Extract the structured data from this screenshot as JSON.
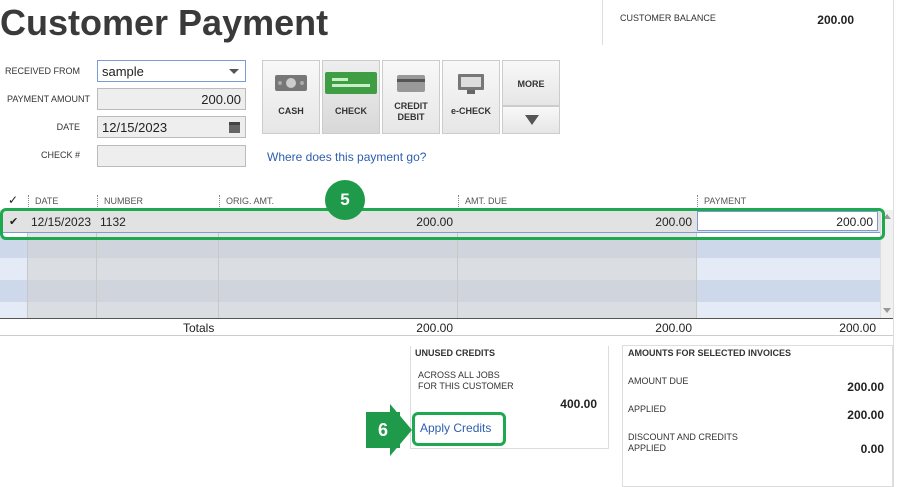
{
  "header": {
    "title": "Customer Payment",
    "customer_balance_label": "CUSTOMER BALANCE",
    "customer_balance_value": "200.00"
  },
  "form": {
    "received_from_label": "RECEIVED FROM",
    "received_from_value": "sample",
    "payment_amount_label": "PAYMENT AMOUNT",
    "payment_amount_value": "200.00",
    "date_label": "DATE",
    "date_value": "12/15/2023",
    "check_label": "CHECK #",
    "check_value": ""
  },
  "payment_methods": [
    {
      "label": "CASH",
      "icon": "cash-icon"
    },
    {
      "label": "CHECK",
      "icon": "check-icon"
    },
    {
      "label": "CREDIT\nDEBIT",
      "icon": "credit-card-icon"
    },
    {
      "label": "e-CHECK",
      "icon": "echeck-icon"
    },
    {
      "label": "MORE",
      "icon": "chevron-down-icon"
    }
  ],
  "where_link": "Where does this payment go?",
  "table": {
    "check_header": "✓",
    "columns": [
      "DATE",
      "NUMBER",
      "ORIG. AMT.",
      "AMT. DUE",
      "PAYMENT"
    ],
    "rows": [
      {
        "checked": "✔",
        "date": "12/15/2023",
        "number": "1132",
        "orig_amt": "200.00",
        "amt_due": "200.00",
        "payment": "200.00"
      }
    ],
    "totals_label": "Totals",
    "totals": {
      "orig_amt": "200.00",
      "amt_due": "200.00",
      "payment": "200.00"
    }
  },
  "unused_credits": {
    "title": "UNUSED CREDITS",
    "line1": "ACROSS ALL JOBS",
    "line2": "FOR THIS CUSTOMER",
    "value": "400.00",
    "apply_link": "Apply Credits"
  },
  "selected_invoices": {
    "title": "AMOUNTS FOR SELECTED INVOICES",
    "amount_due_label": "AMOUNT DUE",
    "amount_due_value": "200.00",
    "applied_label": "APPLIED",
    "applied_value": "200.00",
    "discount_label_1": "DISCOUNT AND CREDITS",
    "discount_label_2": "APPLIED",
    "discount_value": "0.00"
  },
  "annotations": {
    "step5": "5",
    "step6": "6",
    "accent": "#1e9a4a"
  }
}
